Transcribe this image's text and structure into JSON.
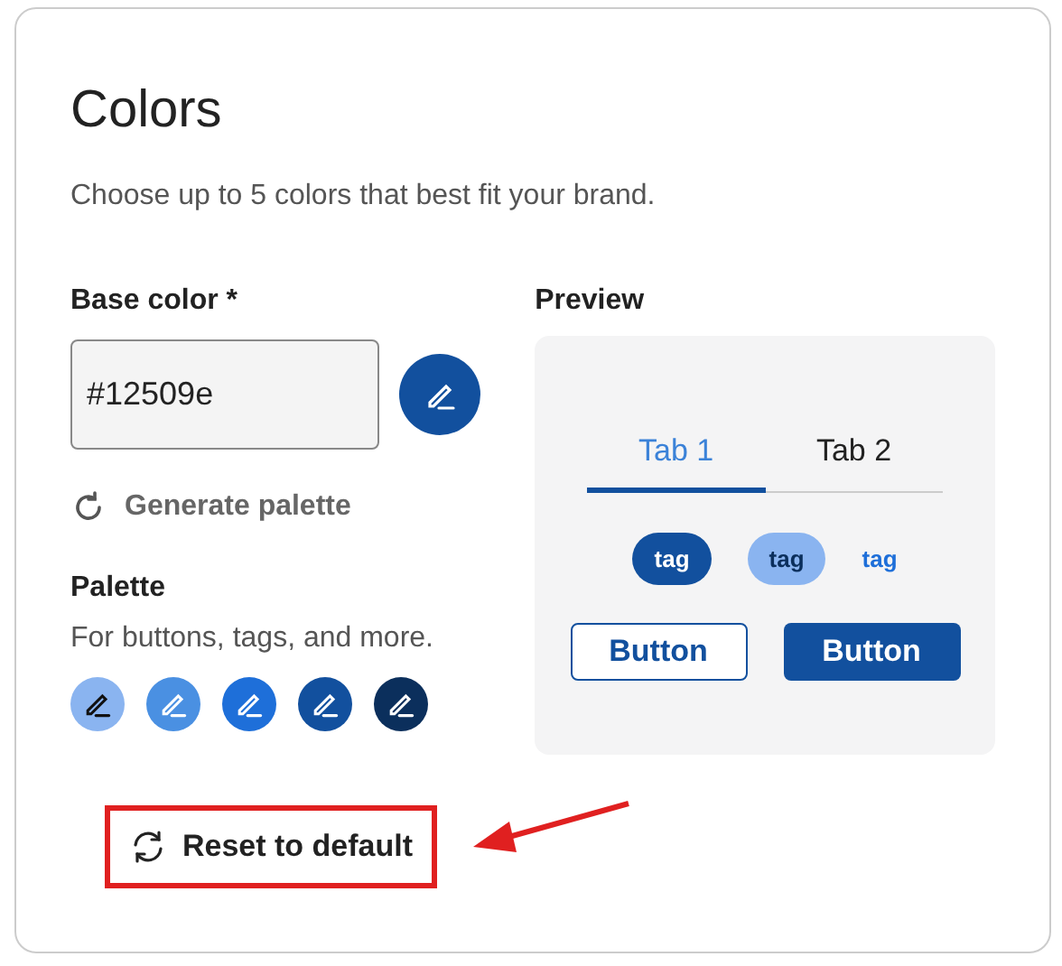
{
  "title": "Colors",
  "description": "Choose up to 5 colors that best fit your brand.",
  "base_color": {
    "label": "Base color *",
    "value": "#12509e",
    "color": "#12509e"
  },
  "generate_label": "Generate palette",
  "palette": {
    "label": "Palette",
    "hint": "For buttons, tags, and more.",
    "swatches": [
      {
        "color": "#8ab4f0"
      },
      {
        "color": "#4a90e2"
      },
      {
        "color": "#1e6fd9"
      },
      {
        "color": "#12509e"
      },
      {
        "color": "#0b2f5c"
      }
    ]
  },
  "preview": {
    "label": "Preview",
    "tabs": [
      {
        "label": "Tab 1",
        "selected": true
      },
      {
        "label": "Tab 2",
        "selected": false
      }
    ],
    "tags": [
      {
        "label": "tag",
        "kind": "filled"
      },
      {
        "label": "tag",
        "kind": "light"
      },
      {
        "label": "tag",
        "kind": "plain"
      }
    ],
    "buttons": [
      {
        "label": "Button",
        "kind": "outline"
      },
      {
        "label": "Button",
        "kind": "filled"
      }
    ]
  },
  "reset_label": "Reset to default"
}
